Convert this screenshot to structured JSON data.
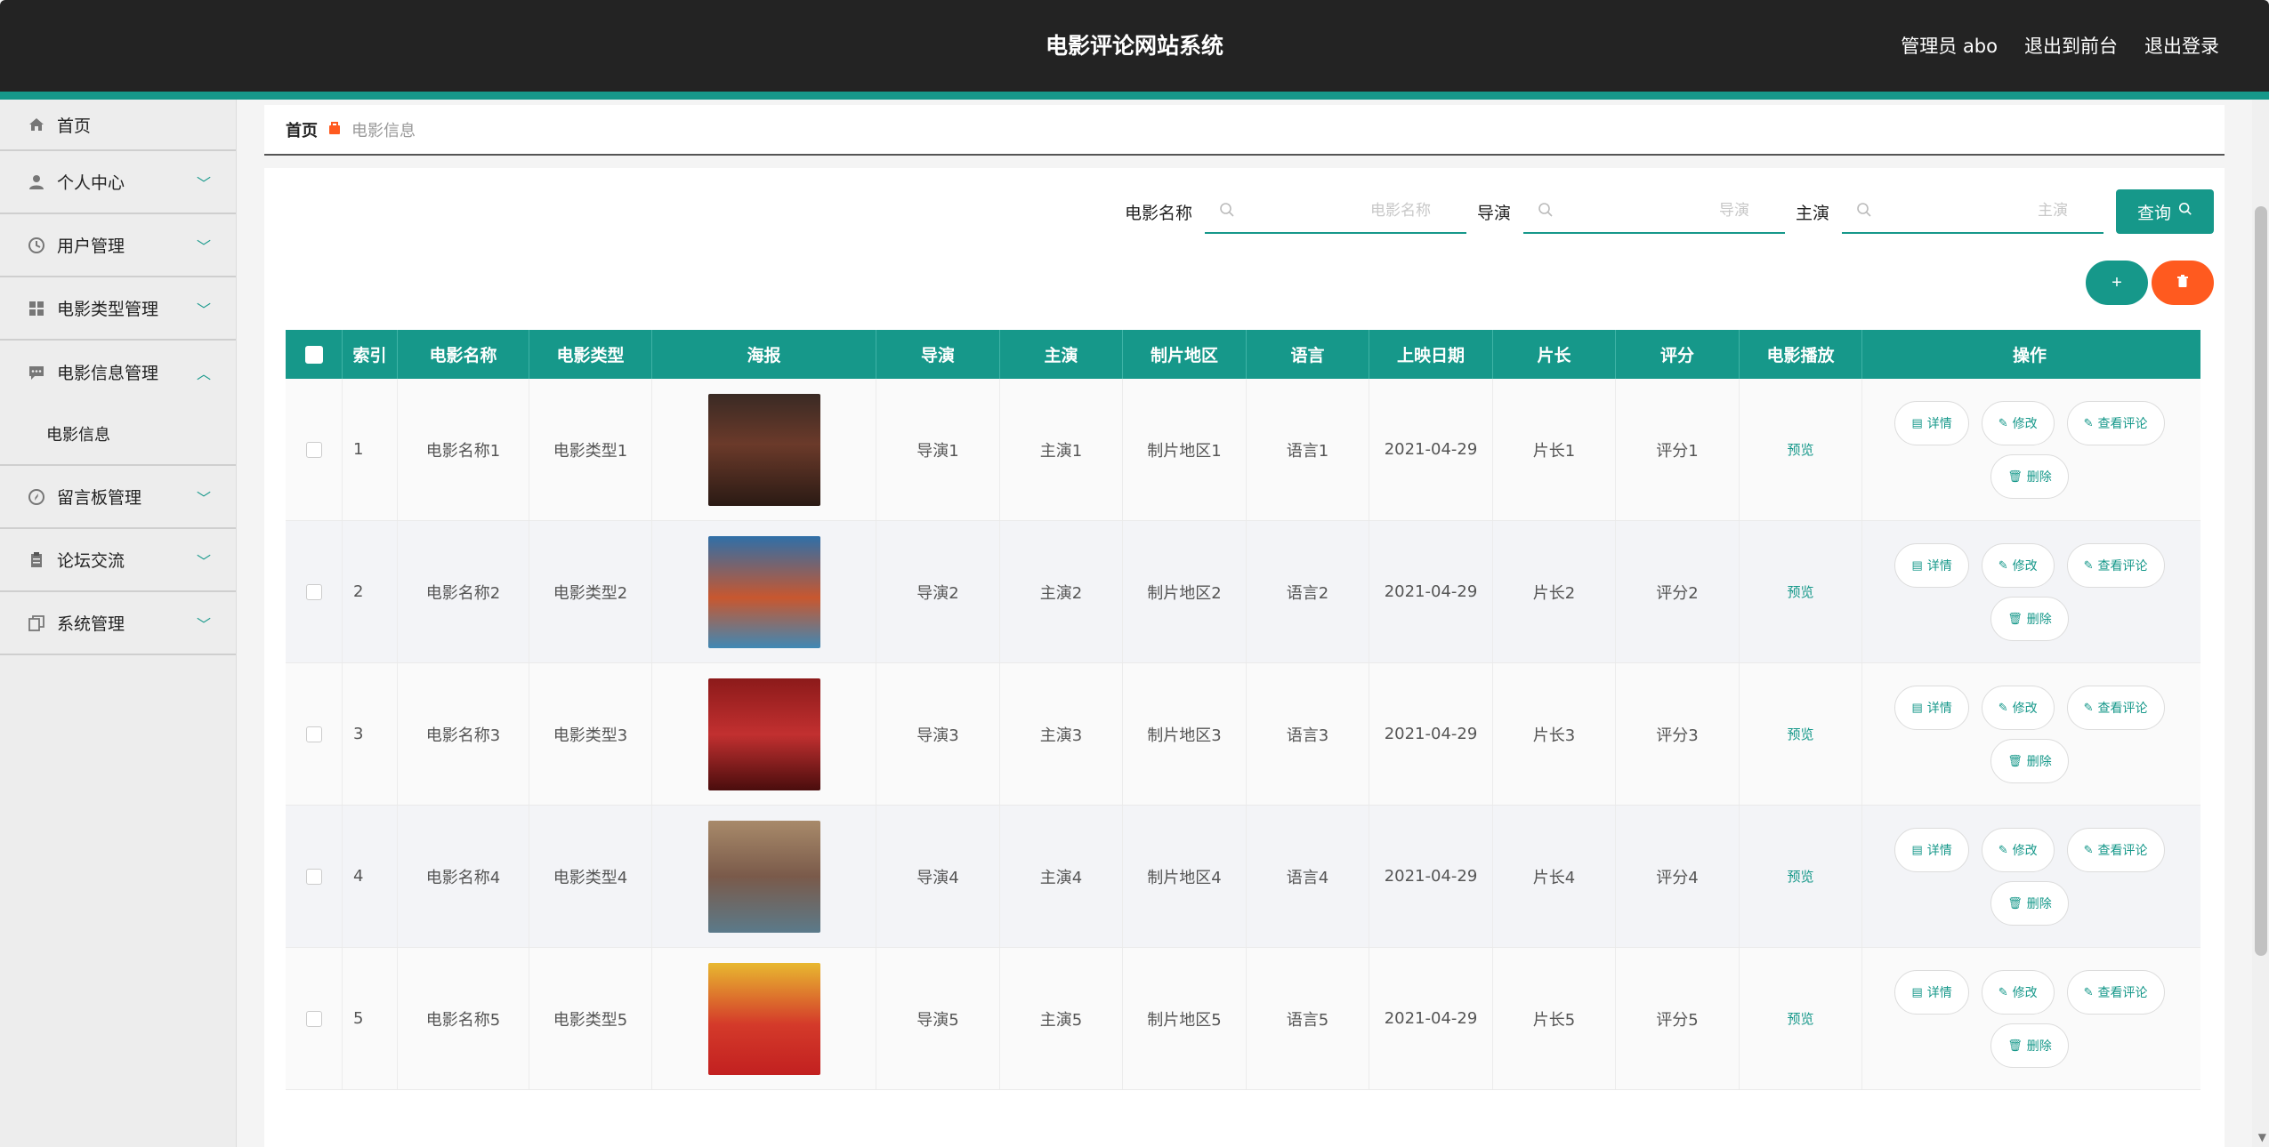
{
  "header": {
    "title": "电影评论网站系统",
    "admin_label": "管理员 abo",
    "back_front": "退出到前台",
    "logout": "退出登录"
  },
  "sidebar": {
    "items": [
      {
        "label": "首页",
        "icon": "home-icon"
      },
      {
        "label": "个人中心",
        "icon": "user-icon"
      },
      {
        "label": "用户管理",
        "icon": "clock-icon"
      },
      {
        "label": "电影类型管理",
        "icon": "grid-icon"
      },
      {
        "label": "电影信息管理",
        "icon": "chat-icon"
      },
      {
        "label": "留言板管理",
        "icon": "compass-icon"
      },
      {
        "label": "论坛交流",
        "icon": "clipboard-icon"
      },
      {
        "label": "系统管理",
        "icon": "copy-icon"
      }
    ],
    "sub_item": "电影信息"
  },
  "breadcrumb": {
    "home": "首页",
    "current": "电影信息"
  },
  "search": {
    "name_label": "电影名称",
    "name_placeholder": "电影名称",
    "director_label": "导演",
    "director_placeholder": "导演",
    "actor_label": "主演",
    "actor_placeholder": "主演",
    "query_label": "查询"
  },
  "actions": {
    "add": "+",
    "delete": "🗑"
  },
  "table": {
    "columns": [
      "索引",
      "电影名称",
      "电影类型",
      "海报",
      "导演",
      "主演",
      "制片地区",
      "语言",
      "上映日期",
      "片长",
      "评分",
      "电影播放",
      "操作"
    ],
    "rows": [
      {
        "index": "1",
        "name": "电影名称1",
        "type": "电影类型1",
        "director": "导演1",
        "actor": "主演1",
        "region": "制片地区1",
        "language": "语言1",
        "date": "2021-04-29",
        "length": "片长1",
        "score": "评分1",
        "play": "预览"
      },
      {
        "index": "2",
        "name": "电影名称2",
        "type": "电影类型2",
        "director": "导演2",
        "actor": "主演2",
        "region": "制片地区2",
        "language": "语言2",
        "date": "2021-04-29",
        "length": "片长2",
        "score": "评分2",
        "play": "预览"
      },
      {
        "index": "3",
        "name": "电影名称3",
        "type": "电影类型3",
        "director": "导演3",
        "actor": "主演3",
        "region": "制片地区3",
        "language": "语言3",
        "date": "2021-04-29",
        "length": "片长3",
        "score": "评分3",
        "play": "预览"
      },
      {
        "index": "4",
        "name": "电影名称4",
        "type": "电影类型4",
        "director": "导演4",
        "actor": "主演4",
        "region": "制片地区4",
        "language": "语言4",
        "date": "2021-04-29",
        "length": "片长4",
        "score": "评分4",
        "play": "预览"
      },
      {
        "index": "5",
        "name": "电影名称5",
        "type": "电影类型5",
        "director": "导演5",
        "actor": "主演5",
        "region": "制片地区5",
        "language": "语言5",
        "date": "2021-04-29",
        "length": "片长5",
        "score": "评分5",
        "play": "预览"
      }
    ],
    "op_labels": {
      "detail": "详情",
      "edit": "修改",
      "comments": "查看评论",
      "delete": "删除"
    }
  },
  "colors": {
    "accent": "#16988a",
    "danger": "#ff5a1f",
    "header_bg": "#232323"
  }
}
